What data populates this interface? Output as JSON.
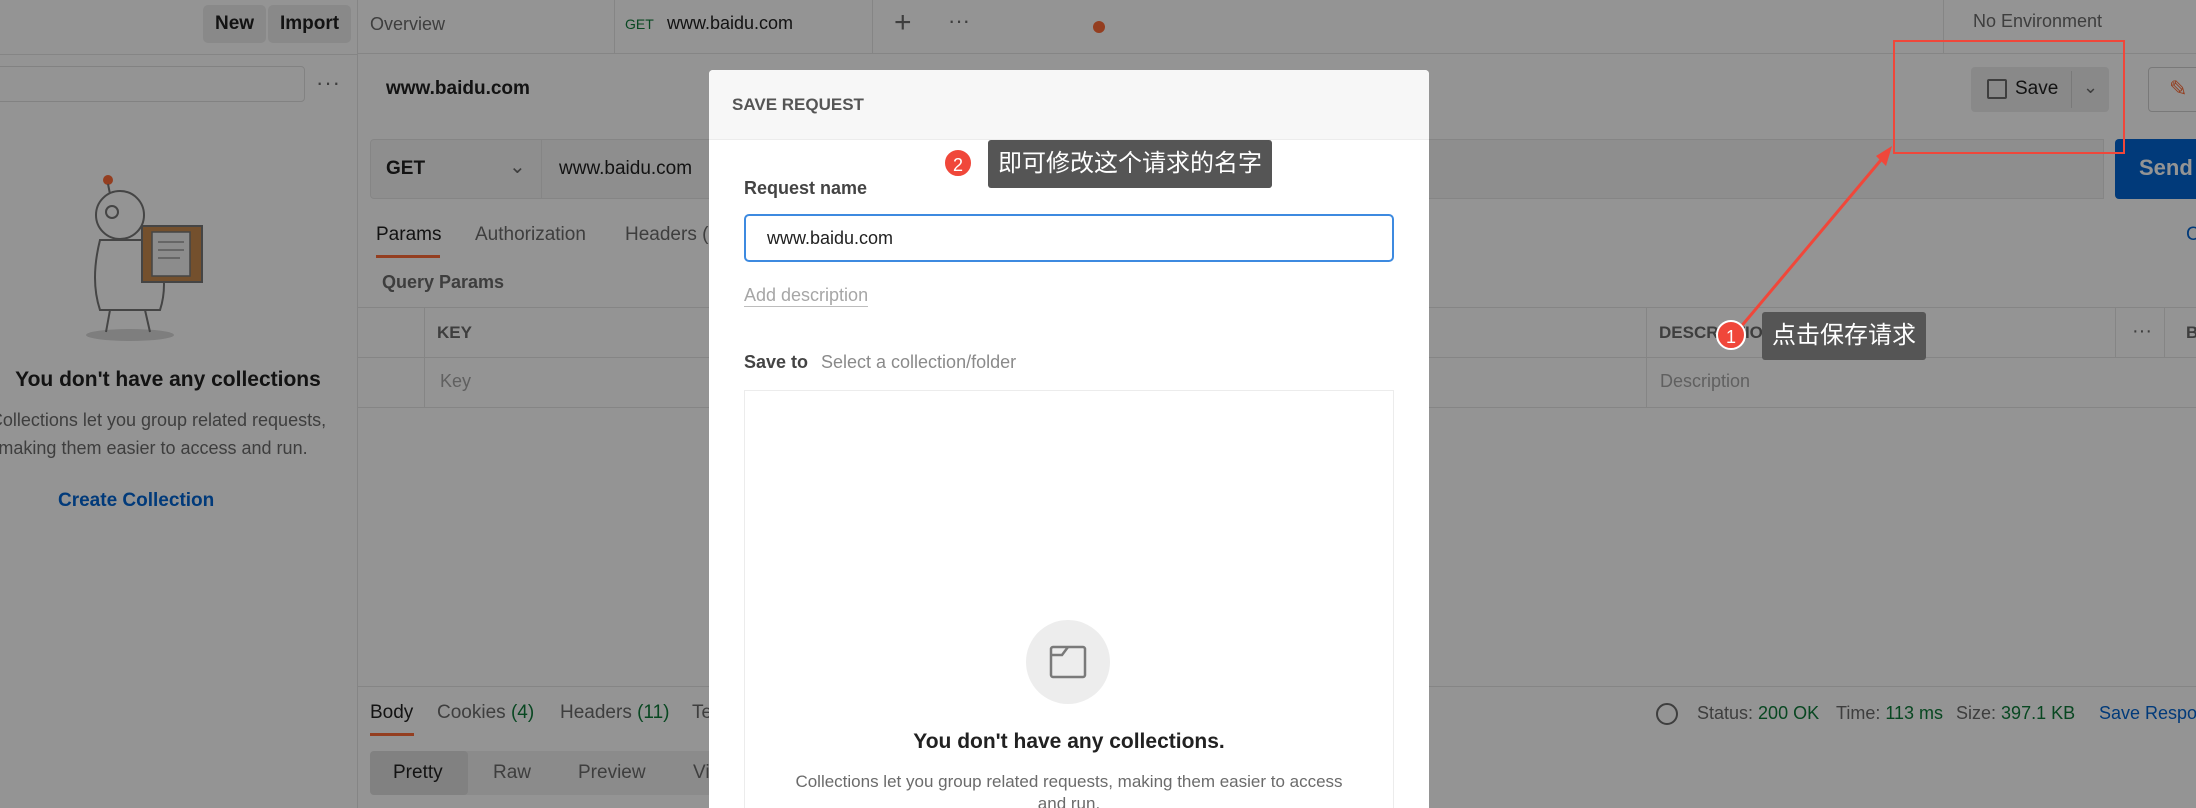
{
  "header": {
    "new_label": "New",
    "import_label": "Import"
  },
  "tabs": {
    "overview_label": "Overview",
    "active_method": "GET",
    "active_title": "www.baidu.com",
    "environment": "No Environment"
  },
  "sidebar": {
    "empty_title": "You don't have any collections",
    "empty_desc_line1": "Collections let you group related requests,",
    "empty_desc_line2": "making them easier to access and run.",
    "create_label": "Create Collection"
  },
  "request": {
    "title": "www.baidu.com",
    "save_label": "Save",
    "method": "GET",
    "url": "www.baidu.com",
    "send_label": "Send",
    "tabs": [
      "Params",
      "Authorization",
      "Headers ("
    ],
    "query_params_label": "Query Params",
    "col_key": "KEY",
    "col_description": "DESCRIPTION",
    "key_placeholder": "Key",
    "desc_placeholder": "Description",
    "bulk_label": "B",
    "cookies_label": "C"
  },
  "response": {
    "tabs": [
      {
        "label": "Body",
        "count": ""
      },
      {
        "label": "Cookies",
        "count": "(4)"
      },
      {
        "label": "Headers",
        "count": "(11)"
      },
      {
        "label": "Te",
        "count": ""
      }
    ],
    "status_label": "Status:",
    "status_value": "200 OK",
    "time_label": "Time:",
    "time_value": "113 ms",
    "size_label": "Size:",
    "size_value": "397.1 KB",
    "save_response_label": "Save Respo",
    "view_modes": [
      "Pretty",
      "Raw",
      "Preview",
      "Vi"
    ]
  },
  "modal": {
    "title": "SAVE REQUEST",
    "request_name_label": "Request name",
    "request_name_value": "www.baidu.com",
    "add_description": "Add description",
    "save_to_label": "Save to",
    "save_to_placeholder": "Select a collection/folder",
    "empty_title": "You don't have any collections.",
    "empty_desc_line1": "Collections let you group related requests, making them easier to access",
    "empty_desc_line2": "and run."
  },
  "annotations": {
    "callout1_number": "1",
    "callout1_text": "点击保存请求",
    "callout2_number": "2",
    "callout2_text": "即可修改这个请求的名字"
  },
  "colors": {
    "accent": "#ff6c37",
    "send_blue": "#0265d2",
    "link_blue": "#0265d2",
    "annotation_red": "#f0473a",
    "status_green": "#0f7b3a"
  }
}
